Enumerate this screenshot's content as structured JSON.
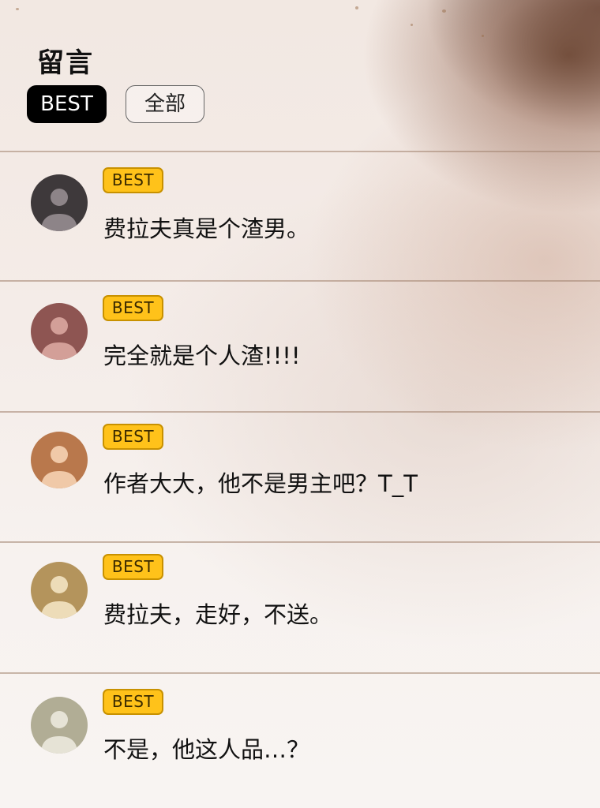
{
  "header": {
    "title": "留言",
    "tabs": [
      {
        "label": "BEST",
        "active": true
      },
      {
        "label": "全部",
        "active": false
      }
    ]
  },
  "colors": {
    "badge_bg": "#ffc21a",
    "badge_border": "#c89100",
    "active_tab_bg": "#000000"
  },
  "comments": [
    {
      "badge": "BEST",
      "text": "费拉夫真是个渣男。",
      "avatar_color": "#3e393b",
      "avatar_fg": "#8d8488"
    },
    {
      "badge": "BEST",
      "text": "完全就是个人渣!!!!",
      "avatar_color": "#8e5552",
      "avatar_fg": "#d39f98"
    },
    {
      "badge": "BEST",
      "text": "作者大大，他不是男主吧？T_T",
      "avatar_color": "#b9784c",
      "avatar_fg": "#f0c9a8"
    },
    {
      "badge": "BEST",
      "text": "费拉夫，走好，不送。",
      "avatar_color": "#b4945c",
      "avatar_fg": "#eddcb8"
    },
    {
      "badge": "BEST",
      "text": "不是，他这人品…？",
      "avatar_color": "#b1ad95",
      "avatar_fg": "#e6e3d6"
    }
  ]
}
